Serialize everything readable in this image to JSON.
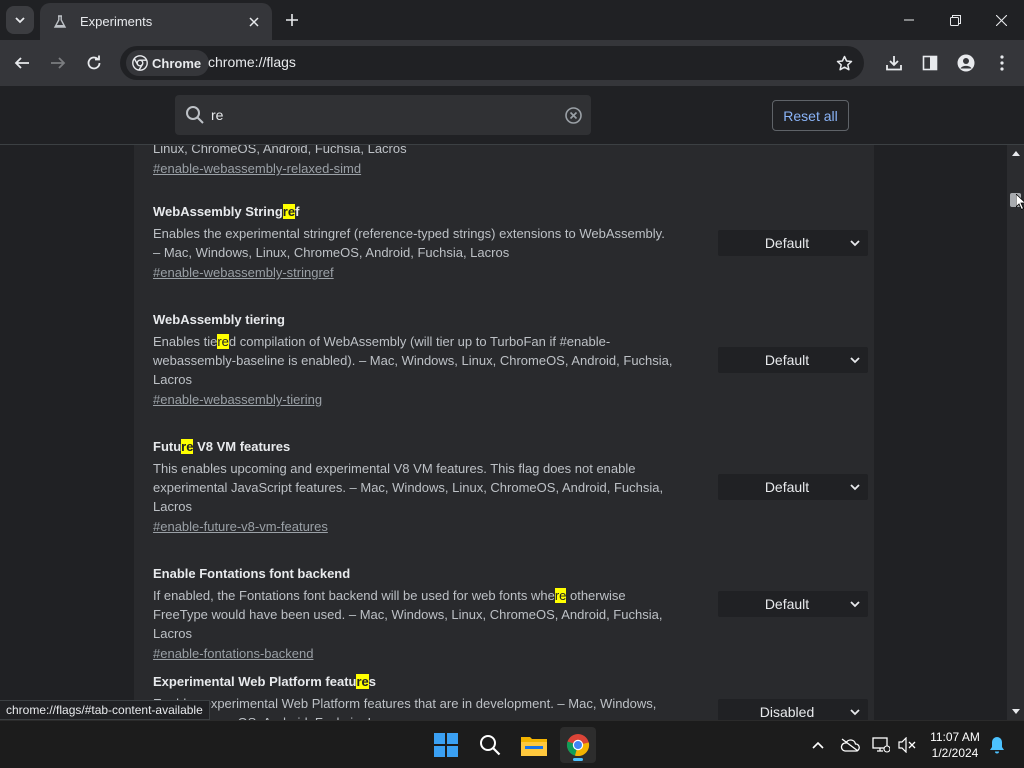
{
  "browser": {
    "tab_title": "Experiments",
    "chip_label": "Chrome",
    "url": "chrome://flags"
  },
  "flags_header": {
    "search_value": "re",
    "reset_label": "Reset all"
  },
  "flags": [
    {
      "desc_tail": "Linux, ChromeOS, Android, Fuchsia, Lacros",
      "link": "#enable-webassembly-relaxed-simd"
    },
    {
      "title_pre": "WebAssembly String",
      "title_hl": "re",
      "title_post": "f",
      "desc": "Enables the experimental stringref (reference-typed strings) extensions to WebAssembly. – Mac, Windows, Linux, ChromeOS, Android, Fuchsia, Lacros",
      "link": "#enable-webassembly-stringref",
      "select": "Default"
    },
    {
      "title": "WebAssembly tiering",
      "desc_pre": "Enables tie",
      "desc_hl": "re",
      "desc_post": "d compilation of WebAssembly (will tier up to TurboFan if #enable-webassembly-baseline is enabled). – Mac, Windows, Linux, ChromeOS, Android, Fuchsia, Lacros",
      "link": "#enable-webassembly-tiering",
      "select": "Default"
    },
    {
      "title_pre": "Futu",
      "title_hl": "re",
      "title_post": " V8 VM features",
      "desc": "This enables upcoming and experimental V8 VM features. This flag does not enable experimental JavaScript features. – Mac, Windows, Linux, ChromeOS, Android, Fuchsia, Lacros",
      "link": "#enable-future-v8-vm-features",
      "select": "Default"
    },
    {
      "title": "Enable Fontations font backend",
      "desc_pre": "If enabled, the Fontations font backend will be used for web fonts whe",
      "desc_hl": "re",
      "desc_post": " otherwise FreeType would have been used. – Mac, Windows, Linux, ChromeOS, Android, Fuchsia, Lacros",
      "link": "#enable-fontations-backend",
      "select": "Default"
    },
    {
      "title_pre": "Experimental Web Platform featu",
      "title_hl": "re",
      "title_post": "s",
      "desc": "Enables experimental Web Platform features that are in development. – Mac, Windows, Linux, ChromeOS, Android, Fuchsia, Lacros",
      "select": "Disabled"
    }
  ],
  "status_bubble": "chrome://flags/#tab-content-available",
  "taskbar": {
    "time": "11:07 AM",
    "date": "1/2/2024"
  },
  "colors": {
    "highlight": "#ffff00",
    "link": "#8ab4f8",
    "panel": "#292a2d",
    "page": "#202124"
  }
}
